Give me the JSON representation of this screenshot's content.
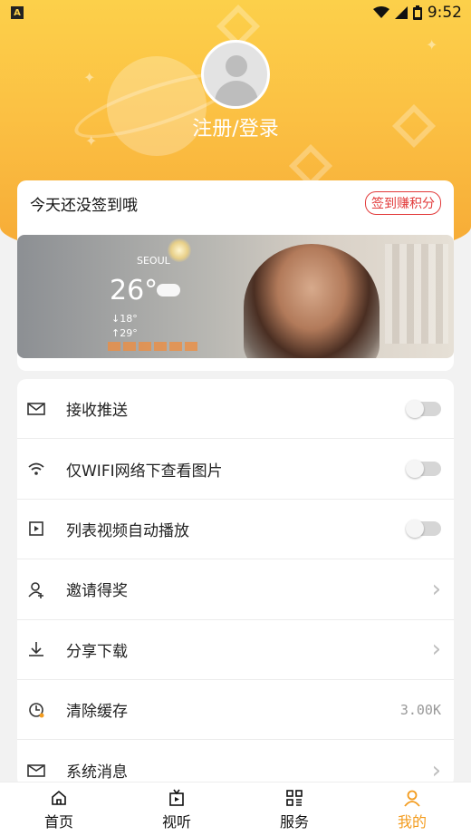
{
  "status_bar": {
    "left_badge": "A",
    "time": "9:52",
    "icons": [
      "wifi-icon",
      "signal-icon",
      "battery-icon"
    ]
  },
  "profile": {
    "login_label": "注册/登录"
  },
  "signin": {
    "prompt": "今天还没签到哦",
    "button": "签到赚积分"
  },
  "banner": {
    "city": "SEOUL",
    "temperature": "26°",
    "low": "↓18°",
    "high": "↑29°"
  },
  "settings": {
    "items": [
      {
        "label": "接收推送",
        "icon": "mail-icon",
        "control": "toggle",
        "enabled": false
      },
      {
        "label": "仅WIFI网络下查看图片",
        "icon": "wifi-icon",
        "control": "toggle",
        "enabled": false
      },
      {
        "label": "列表视频自动播放",
        "icon": "video-play-icon",
        "control": "toggle",
        "enabled": false
      },
      {
        "label": "邀请得奖",
        "icon": "add-user-icon",
        "control": "chevron"
      },
      {
        "label": "分享下载",
        "icon": "download-icon",
        "control": "chevron"
      },
      {
        "label": "清除缓存",
        "icon": "clock-icon",
        "control": "value",
        "value": "3.00K"
      },
      {
        "label": "系统消息",
        "icon": "message-icon",
        "control": "chevron"
      }
    ]
  },
  "tabs": [
    {
      "label": "首页",
      "icon": "home-icon",
      "active": false
    },
    {
      "label": "视听",
      "icon": "tv-icon",
      "active": false
    },
    {
      "label": "服务",
      "icon": "grid-icon",
      "active": false
    },
    {
      "label": "我的",
      "icon": "user-icon",
      "active": true
    }
  ],
  "colors": {
    "header_top": "#fcd04a",
    "header_bottom": "#f6a935",
    "accent": "#f39c1f",
    "signin_red": "#e23a3a"
  }
}
